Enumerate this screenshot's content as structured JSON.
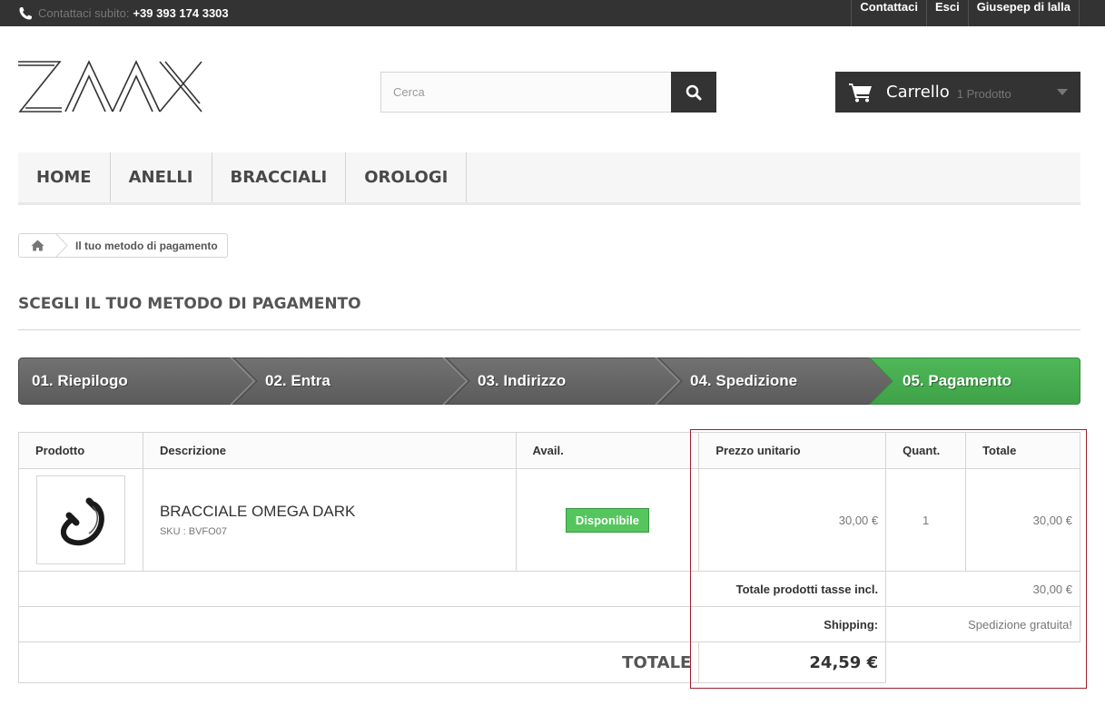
{
  "topbar": {
    "phone_label": "Contattaci subito:",
    "phone_number": "+39 393 174 3303",
    "links": [
      "Contattaci",
      "Esci",
      "Giusepep di lalla"
    ]
  },
  "header": {
    "logo_text": "ZAAX",
    "search_placeholder": "Cerca",
    "cart_title": "Carrello",
    "cart_count": "1 Prodotto"
  },
  "menu": {
    "items": [
      "HOME",
      "ANELLI",
      "BRACCIALI",
      "OROLOGI"
    ]
  },
  "breadcrumb": {
    "current": "Il tuo metodo di pagamento"
  },
  "page_title": "SCEGLI IL TUO METODO DI PAGAMENTO",
  "steps": [
    "01. Riepilogo",
    "02. Entra",
    "03. Indirizzo",
    "04. Spedizione",
    "05. Pagamento"
  ],
  "table": {
    "headers": [
      "Prodotto",
      "Descrizione",
      "Avail.",
      "Prezzo unitario",
      "Quant.",
      "Totale"
    ],
    "product": {
      "name": "BRACCIALE OMEGA DARK",
      "sku": "SKU : BVFO07",
      "availability": "Disponibile",
      "unit_price": "30,00 €",
      "quantity": "1",
      "total": "30,00 €"
    },
    "subtotal_label": "Totale prodotti tasse incl.",
    "subtotal_value": "30,00 €",
    "shipping_label": "Shipping:",
    "shipping_value": "Spedizione gratuita!",
    "total_label": "TOTALE",
    "total_value": "24,59 €"
  },
  "colors": {
    "topbar": "#333333",
    "step_inactive": "#666666",
    "step_active": "#46a74e",
    "available": "#55c65e",
    "highlight": "#a01f2b"
  }
}
